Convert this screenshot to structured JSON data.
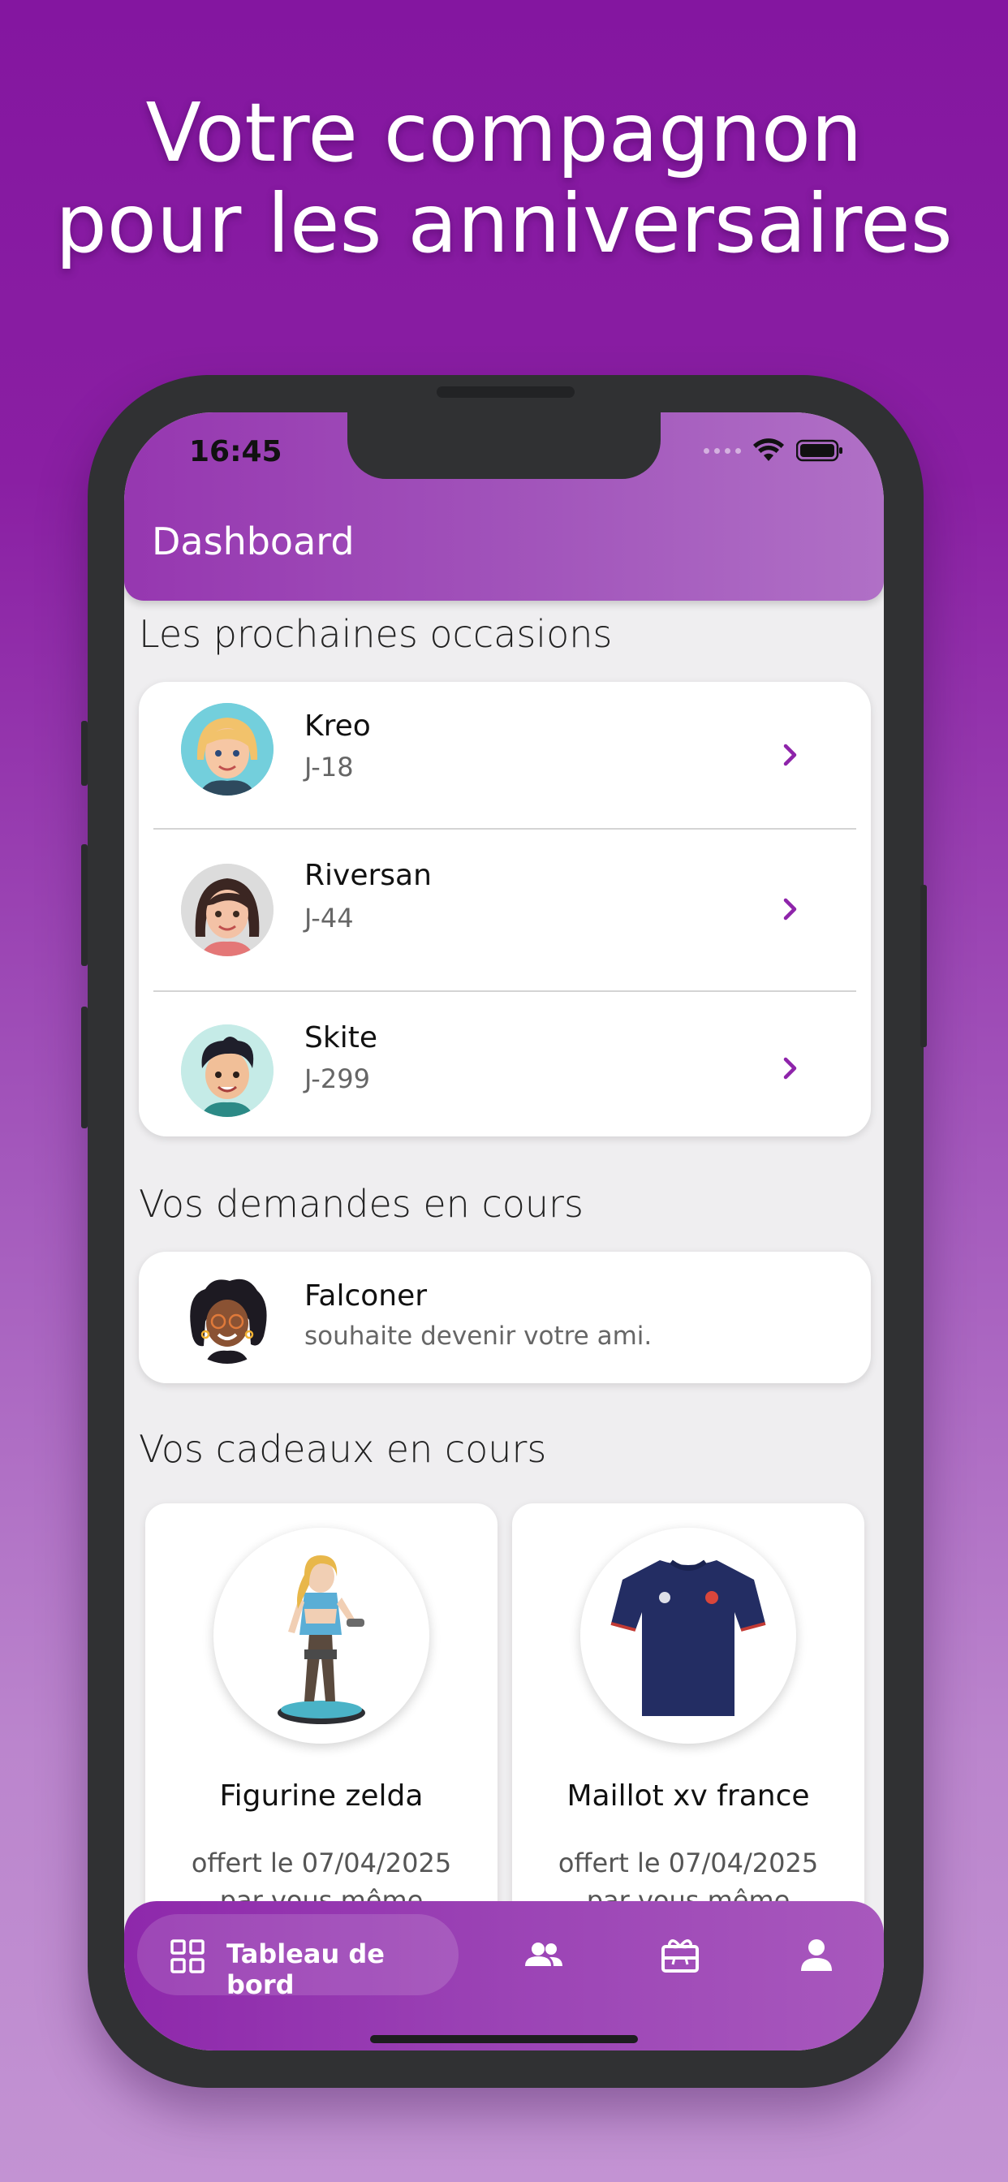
{
  "headline": {
    "line1": "Votre compagnon",
    "line2": "pour les anniversaires"
  },
  "status_bar": {
    "time": "16:45"
  },
  "app_bar": {
    "title": "Dashboard"
  },
  "occasions": {
    "title": "Les prochaines occasions",
    "items": [
      {
        "name": "Kreo",
        "days": "J-18"
      },
      {
        "name": "Riversan",
        "days": "J-44"
      },
      {
        "name": "Skite",
        "days": "J-299"
      }
    ]
  },
  "requests": {
    "title": "Vos demandes en cours",
    "items": [
      {
        "name": "Falconer",
        "message": "souhaite devenir votre ami."
      }
    ]
  },
  "gifts": {
    "title": "Vos cadeaux en cours",
    "items": [
      {
        "name": "Figurine zelda",
        "date": "offert le 07/04/2025",
        "by": "par vous même"
      },
      {
        "name": "Maillot xv france",
        "date": "offert le 07/04/2025",
        "by": "par vous même"
      }
    ]
  },
  "bottom_nav": {
    "active_label": "Tableau de bord",
    "icons": [
      "dashboard-icon",
      "friends-icon",
      "gift-icon",
      "profile-icon"
    ]
  },
  "colors": {
    "accent": "#8e24aa",
    "background": "#8416a0"
  }
}
